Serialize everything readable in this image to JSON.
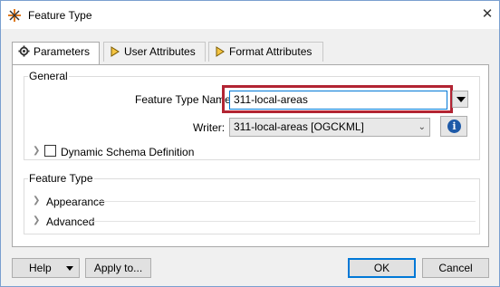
{
  "window": {
    "title": "Feature Type"
  },
  "tabs": [
    {
      "label": "Parameters",
      "icon": "gear-icon"
    },
    {
      "label": "User Attributes",
      "icon": "attribute-arrow-icon"
    },
    {
      "label": "Format Attributes",
      "icon": "attribute-arrow-icon"
    }
  ],
  "general": {
    "group_label": "General",
    "feature_type_name_label": "Feature Type Name:",
    "feature_type_name_value": "311-local-areas",
    "writer_label": "Writer:",
    "writer_value": "311-local-areas [OGCKML]",
    "dynamic_schema_label": "Dynamic Schema Definition"
  },
  "feature_type_group": {
    "group_label": "Feature Type",
    "appearance_label": "Appearance",
    "advanced_label": "Advanced"
  },
  "buttons": {
    "help": "Help",
    "apply_to": "Apply to...",
    "ok": "OK",
    "cancel": "Cancel"
  },
  "colors": {
    "highlight": "#b22433",
    "info": "#1e5aa8",
    "focus": "#0078d7"
  }
}
